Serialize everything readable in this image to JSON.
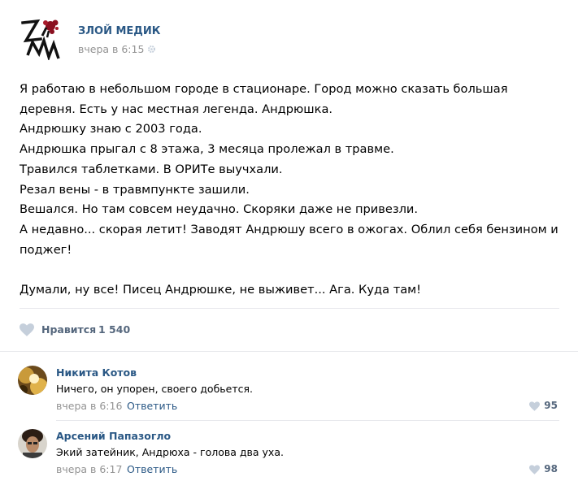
{
  "post": {
    "author": "ЗЛОЙ МЕДИК",
    "time": "вчера в 6:15",
    "lines": [
      "Я работаю в небольшом городе в стационаре. Город можно сказать большая",
      "деревня. Есть у нас местная легенда. Андрюшка.",
      "Андрюшку знаю с 2003 года.",
      "Андрюшка прыгал с 8 этажа, 3 месяца пролежал в травме.",
      "Травился таблетками. В ОРИТе выучхали.",
      "Резал вены - в травмпункте зашили.",
      "Вешался. Но там совсем неудачно. Скоряки даже не привезли.",
      "А недавно... скорая летит! Заводят Андрюшу всего в ожогах. Облил себя бензином и",
      "поджег!",
      "",
      "Думали, ну все! Писец Андрюшке, не выживет... Ага. Куда там!"
    ],
    "likes_label": "Нравится",
    "likes_count": "1 540"
  },
  "comments": [
    {
      "author": "Никита Котов",
      "text": "Ничего, он упорен, своего добьется.",
      "date": "вчера в 6:16",
      "reply_label": "Ответить",
      "likes": "95"
    },
    {
      "author": "Арсений Папазогло",
      "text": "Экий затейник, Андрюха - голова два уха.",
      "date": "вчера в 6:17",
      "reply_label": "Ответить",
      "likes": "98"
    }
  ],
  "icons": {
    "gear": "gear-icon",
    "heart": "heart-icon",
    "logo": "zm-logo"
  },
  "colors": {
    "link": "#2a5885",
    "muted": "#939393",
    "heart": "#c5cfdb",
    "divider": "#e7e8ec",
    "logo_accent": "#8a1020"
  }
}
